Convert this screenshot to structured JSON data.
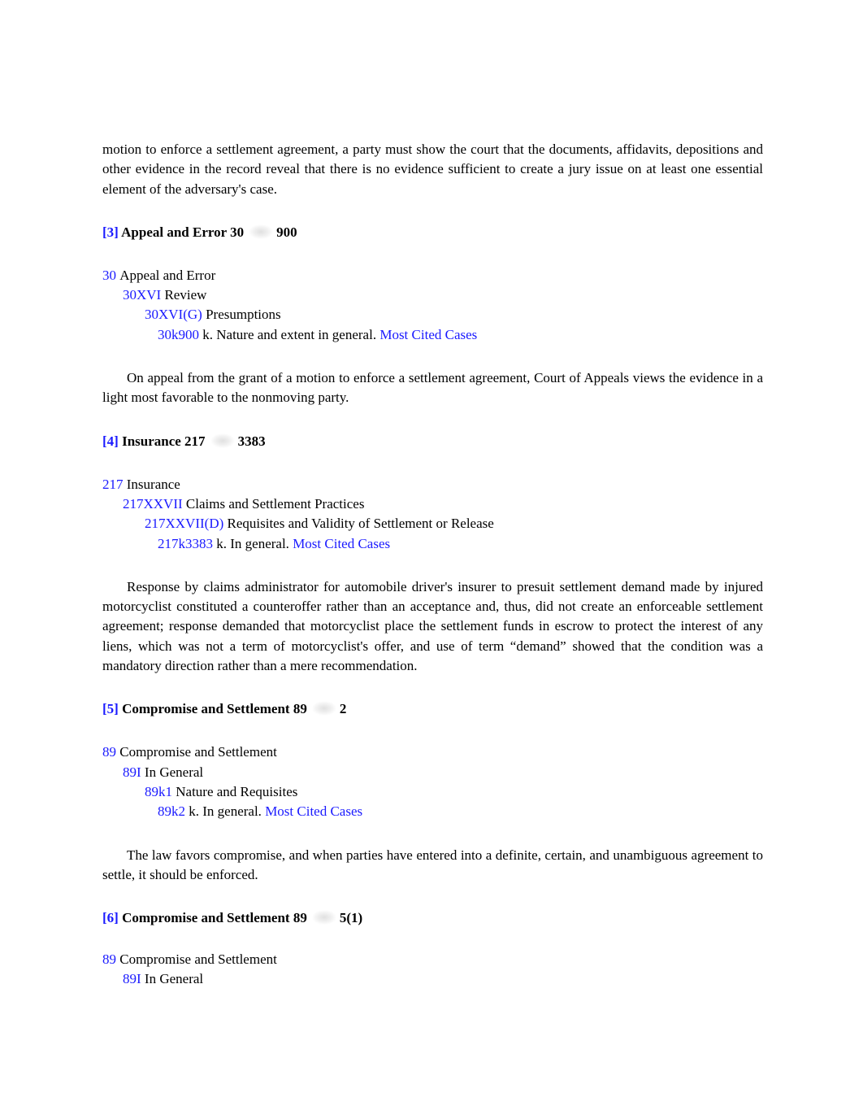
{
  "intro_paragraph": "motion to enforce a settlement agreement, a party must show the court that the documents, affidavits, depositions and other evidence in the record reveal that there is no evidence sufficient to create a jury issue on at least one essential element of the adversary's case.",
  "headnotes": [
    {
      "number": "[3]",
      "topic": "Appeal and Error 30",
      "key": "900",
      "key_icon": "key-number-icon",
      "tree": [
        {
          "code": "30",
          "label": "Appeal and Error"
        },
        {
          "code": "30XVI",
          "label": "Review"
        },
        {
          "code": "30XVI(G)",
          "label": "Presumptions"
        },
        {
          "code": "30k900",
          "label": "k. Nature and extent in general.",
          "link": "Most Cited Cases"
        }
      ],
      "summary": "On appeal from the grant of a motion to enforce a settlement agreement, Court of Appeals views the evidence in a light most favorable to the nonmoving party."
    },
    {
      "number": "[4]",
      "topic": "Insurance 217",
      "key": "3383",
      "key_icon": "key-number-icon",
      "tree": [
        {
          "code": "217",
          "label": "Insurance"
        },
        {
          "code": "217XXVII",
          "label": "Claims and Settlement Practices"
        },
        {
          "code": "217XXVII(D)",
          "label": "Requisites and Validity of Settlement or Release"
        },
        {
          "code": "217k3383",
          "label": "k. In general.",
          "link": "Most Cited Cases"
        }
      ],
      "summary": "Response by claims administrator for automobile driver's insurer to presuit settlement demand made by injured motorcyclist constituted a counteroffer rather than an acceptance and, thus, did not create an enforceable settlement agreement; response demanded that motorcyclist place the settlement funds in escrow to protect the interest of any liens, which was not a term of motorcyclist's offer, and use of term “demand” showed that the condition was a mandatory direction rather than a mere recommendation."
    },
    {
      "number": "[5]",
      "topic": "Compromise and Settlement 89",
      "key": "2",
      "key_icon": "key-number-icon",
      "tree": [
        {
          "code": "89",
          "label": "Compromise and Settlement"
        },
        {
          "code": "89I",
          "label": "In General"
        },
        {
          "code": "89k1",
          "label": "Nature and Requisites"
        },
        {
          "code": "89k2",
          "label": "k. In general.",
          "link": "Most Cited Cases"
        }
      ],
      "summary": "The law favors compromise, and when parties have entered into a definite, certain, and unambiguous agreement to settle, it should be enforced."
    },
    {
      "number": "[6]",
      "topic": "Compromise and Settlement 89",
      "key": "5(1)",
      "key_icon": "key-number-icon",
      "tree": [
        {
          "code": "89",
          "label": "Compromise and Settlement"
        },
        {
          "code": "89I",
          "label": "In General"
        }
      ]
    }
  ],
  "colors": {
    "link": "#1a1aff",
    "text": "#000000"
  }
}
